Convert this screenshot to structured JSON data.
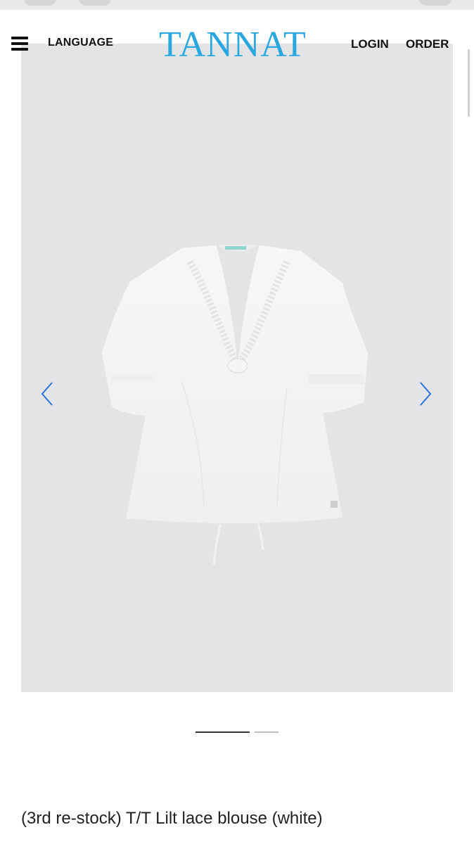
{
  "header": {
    "language_label": "LANGUAGE",
    "brand": "TANNAT",
    "login_label": "LOGIN",
    "order_label": "ORDER"
  },
  "gallery": {
    "image_alt": "white lace blouse",
    "slide_count": 2,
    "active_slide": 1
  },
  "product": {
    "title": "(3rd re-stock) T/T Lilt lace blouse (white)"
  },
  "colors": {
    "brand": "#29a7de",
    "arrows": "#2e6fd8",
    "image_bg": "#e3e4e6"
  }
}
